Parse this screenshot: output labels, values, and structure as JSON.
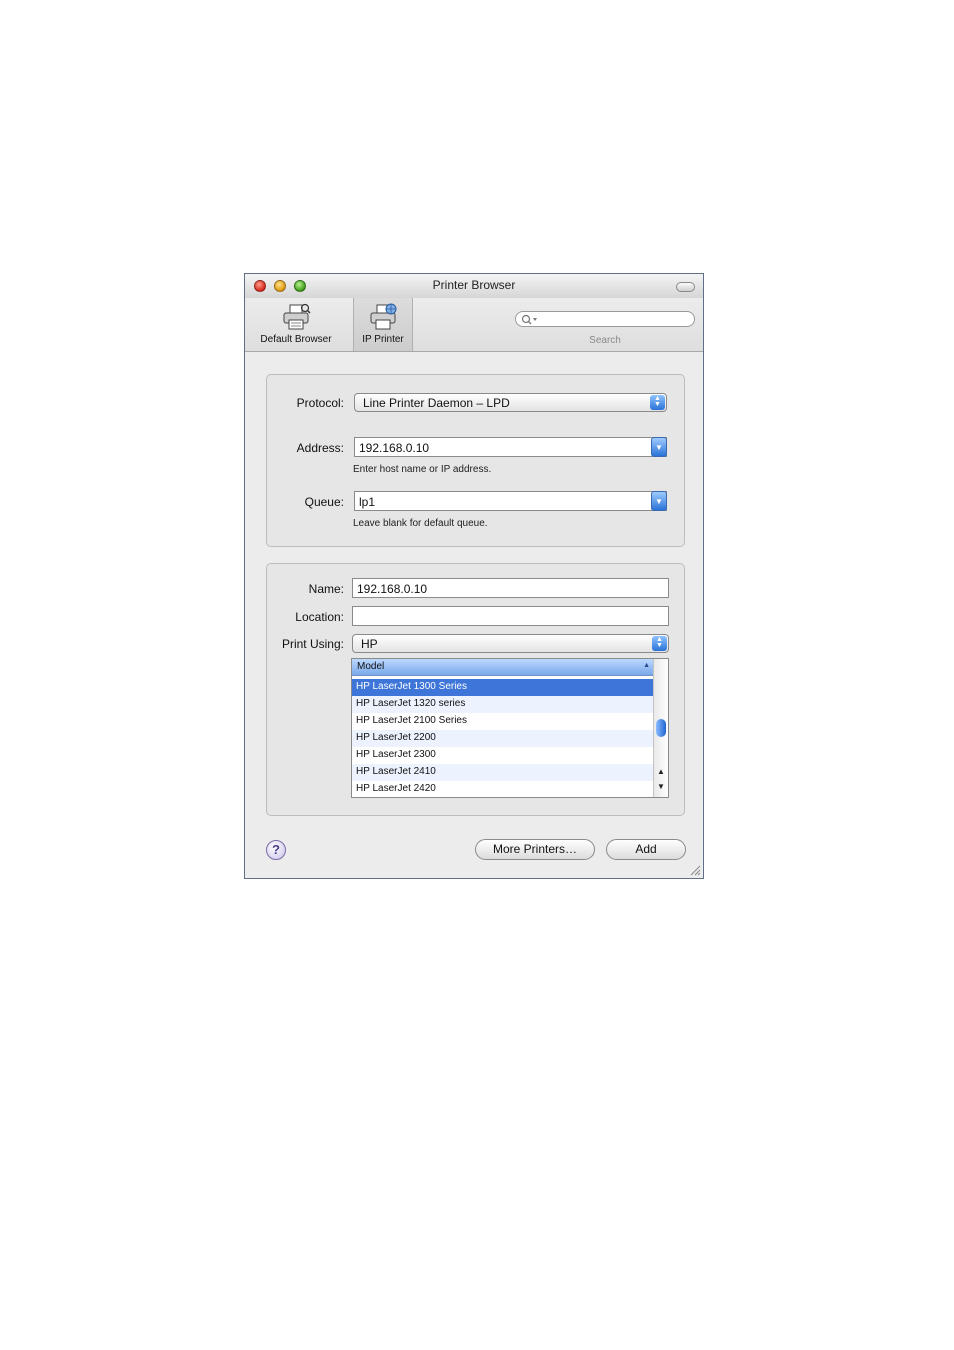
{
  "window": {
    "title": "Printer Browser"
  },
  "toolbar": {
    "default_browser": "Default Browser",
    "ip_printer": "IP Printer",
    "search_label": "Search"
  },
  "connection": {
    "protocol_label": "Protocol:",
    "protocol_value": "Line Printer Daemon – LPD",
    "address_label": "Address:",
    "address_value": "192.168.0.10",
    "address_hint": "Enter host name or IP address.",
    "queue_label": "Queue:",
    "queue_value": "lp1",
    "queue_hint": "Leave blank for default queue."
  },
  "details": {
    "name_label": "Name:",
    "name_value": "192.168.0.10",
    "location_label": "Location:",
    "location_value": "",
    "print_using_label": "Print Using:",
    "print_using_value": "HP"
  },
  "model_list": {
    "header": "Model",
    "rows": [
      "HP LaserJet 1300 Series",
      "HP LaserJet 1320 series",
      "HP LaserJet 2100 Series",
      "HP LaserJet 2200",
      "HP LaserJet 2300",
      "HP LaserJet 2410",
      "HP LaserJet 2420"
    ],
    "selected": "HP LaserJet 1300 Series"
  },
  "buttons": {
    "help": "?",
    "more_printers": "More Printers…",
    "add": "Add"
  },
  "colors": {
    "selection": "#3d75d8",
    "accent": "#2a73d8"
  }
}
